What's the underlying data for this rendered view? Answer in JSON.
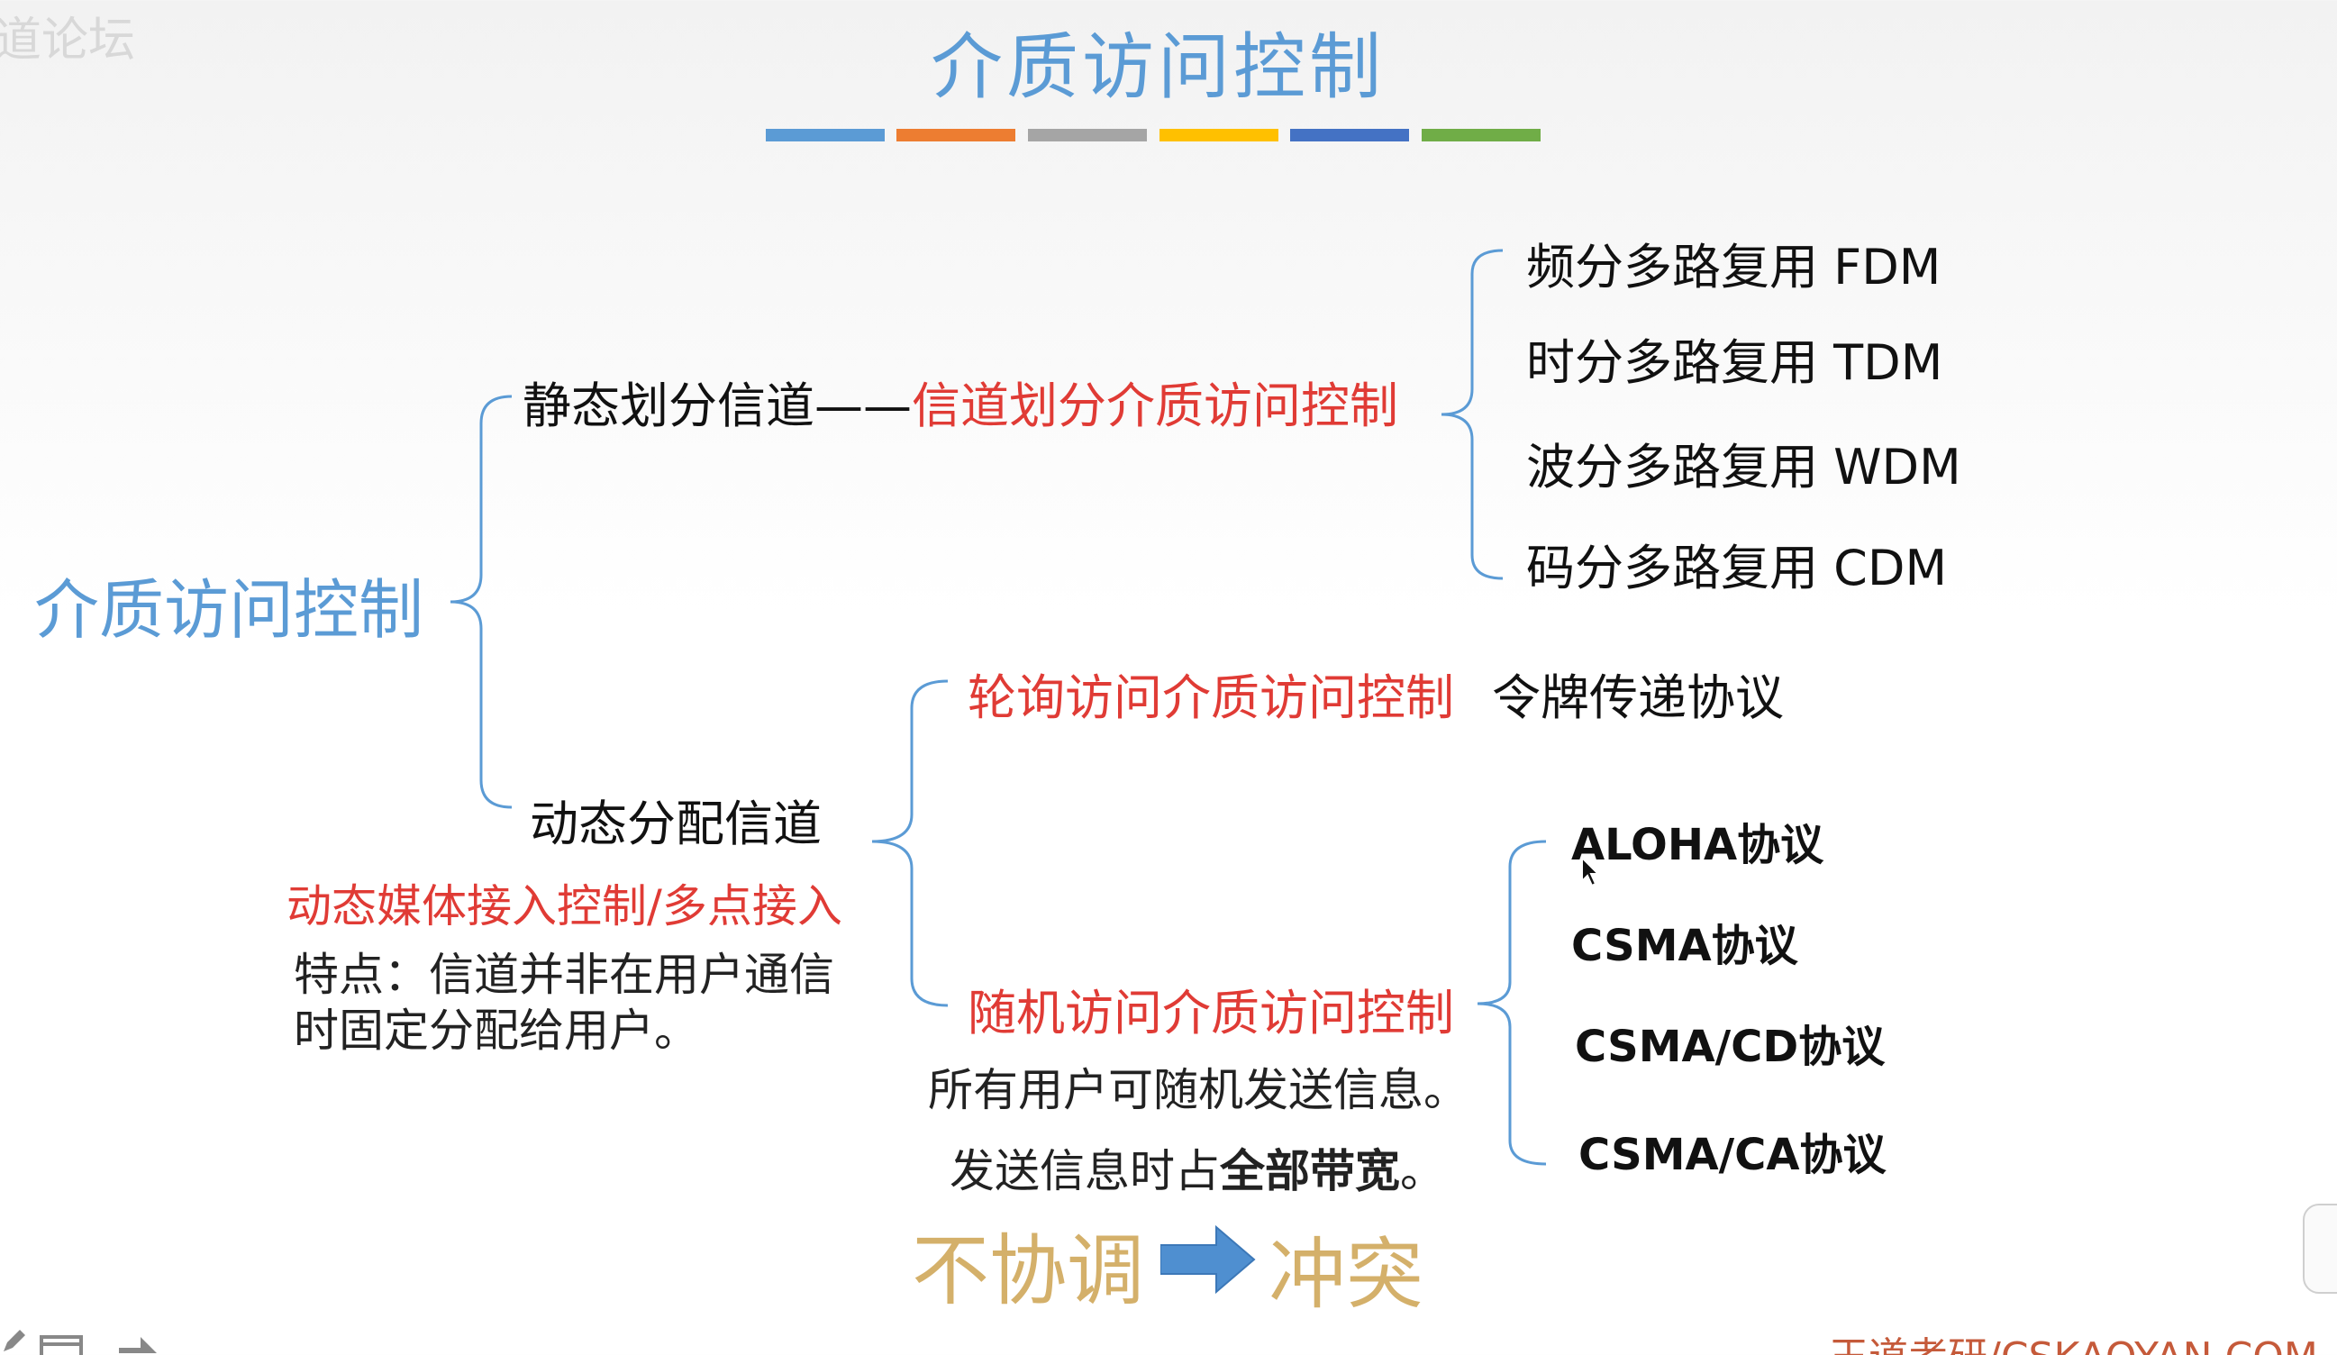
{
  "slide": {
    "title": "介质访问控制",
    "watermark_left": "道论坛",
    "footer": "王道考研/CSKAOYAN.COM"
  },
  "color_bar": [
    "#5b9bd5",
    "#ed7d31",
    "#a5a5a5",
    "#ffc000",
    "#4472c4",
    "#70ad47"
  ],
  "tree": {
    "root": "介质访问控制",
    "static": {
      "label": "静态划分信道——",
      "label_red": "信道划分介质访问控制",
      "children": [
        "频分多路复用 FDM",
        "时分多路复用 TDM",
        "波分多路复用 WDM",
        "码分多路复用 CDM"
      ]
    },
    "dynamic": {
      "label": "动态分配信道",
      "alias": "动态媒体接入控制/多点接入",
      "note_line1": "特点：信道并非在用户通信",
      "note_line2": "时固定分配给用户。",
      "polling": {
        "label": "轮询访问介质访问控制",
        "child": "令牌传递协议"
      },
      "random": {
        "label": "随机访问介质访问控制",
        "note_line1": "所有用户可随机发送信息。",
        "note_line2_prefix": "发送信息时占",
        "note_line2_bold": "全部带宽",
        "note_line2_suffix": "。",
        "children": [
          "ALOHA协议",
          "CSMA协议",
          "CSMA/CD协议",
          "CSMA/CA协议"
        ]
      }
    }
  },
  "conclusion": {
    "left": "不协调",
    "right": "冲突"
  }
}
